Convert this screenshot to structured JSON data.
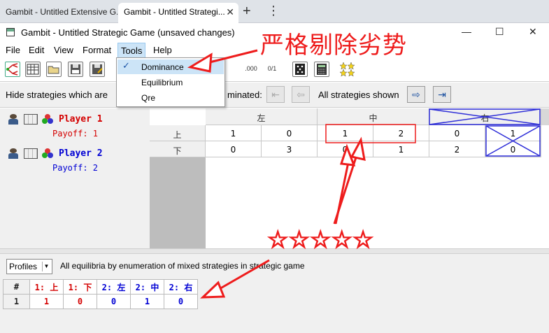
{
  "browser": {
    "tabs": [
      {
        "label": "Gambit - Untitled Extensive G..."
      },
      {
        "label": "Gambit - Untitled Strategi..."
      }
    ],
    "close_glyph": "✕",
    "add_glyph": "+",
    "more_glyph": "⋮"
  },
  "window": {
    "title": "Gambit - Untitled Strategic Game (unsaved changes)",
    "controls": {
      "minimize": "—",
      "maximize": "☐",
      "close": "✕"
    }
  },
  "menu": {
    "items": [
      "File",
      "Edit",
      "View",
      "Format",
      "Tools",
      "Help"
    ],
    "open_menu": "Tools",
    "tools_dropdown": [
      {
        "label": "Dominance",
        "checked": true
      },
      {
        "label": "Equilibrium",
        "checked": false
      },
      {
        "label": "Qre",
        "checked": false
      }
    ],
    "check_glyph": "✓"
  },
  "toolbar": {
    "icons": [
      "tree-icon",
      "table-icon",
      "open-folder-icon",
      "save-icon",
      "save-as-icon",
      "decimal-icon",
      "rational-icon",
      "dice-icon",
      "calculator-icon",
      "stars-icon"
    ],
    "decimal_text": ".000",
    "rational_text": "0/1"
  },
  "dominance_bar": {
    "hide_label": "Hide strategies which are",
    "undominated_label": "minated:",
    "shown_label": "All strategies shown",
    "first_glyph": "⇤",
    "prev_glyph": "⇦",
    "next_glyph": "⇨",
    "last_glyph": "⇥"
  },
  "players": [
    {
      "name": "Player 1",
      "payoff_label": "Payoff: 1",
      "color": "#d40000"
    },
    {
      "name": "Player 2",
      "payoff_label": "Payoff: 2",
      "color": "#0000d4"
    }
  ],
  "matrix": {
    "col_strategies": [
      "左",
      "中",
      "右"
    ],
    "row_strategies": [
      "上",
      "下"
    ],
    "rows": [
      {
        "cells": [
          [
            "1",
            "0"
          ],
          [
            "1",
            "2"
          ],
          [
            "0",
            "1"
          ]
        ]
      },
      {
        "cells": [
          [
            "0",
            "3"
          ],
          [
            "0",
            "1"
          ],
          [
            "2",
            "0"
          ]
        ]
      }
    ],
    "eliminated_column": "右"
  },
  "annotation": {
    "title_cn": "严格剔除劣势",
    "stars": "☆☆☆☆☆",
    "color": "#ee1c1c",
    "cross_color": "#2e2ed8"
  },
  "profiles": {
    "selector_value": "Profiles",
    "description": "All equilibria by enumeration of mixed strategies in strategic game",
    "headers": [
      "#",
      "1: 上",
      "1: 下",
      "2: 左",
      "2: 中",
      "2: 右"
    ],
    "rows": [
      [
        "1",
        "1",
        "0",
        "0",
        "1",
        "0"
      ]
    ]
  }
}
